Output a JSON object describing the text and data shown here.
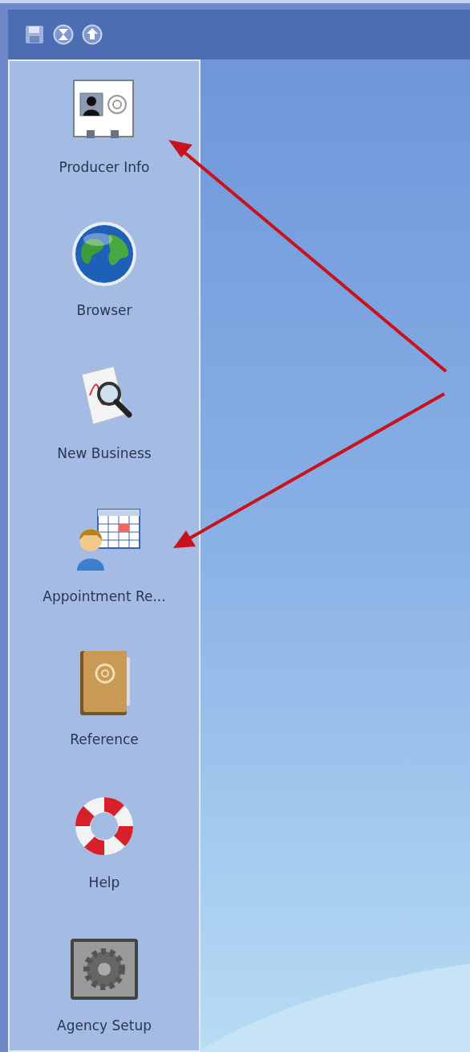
{
  "toolbar": {
    "buttons": [
      {
        "kind": "save"
      },
      {
        "kind": "hourglass"
      },
      {
        "kind": "upload"
      }
    ]
  },
  "sidebar": {
    "items": [
      {
        "label": "Producer Info",
        "kind": "contact-card"
      },
      {
        "label": "Browser",
        "kind": "globe"
      },
      {
        "label": "New Business",
        "kind": "document-search"
      },
      {
        "label": "Appointment Re...",
        "kind": "appointment"
      },
      {
        "label": "Reference",
        "kind": "address-book"
      },
      {
        "label": "Help",
        "kind": "lifebuoy"
      },
      {
        "label": "Agency Setup",
        "kind": "gear"
      }
    ]
  }
}
